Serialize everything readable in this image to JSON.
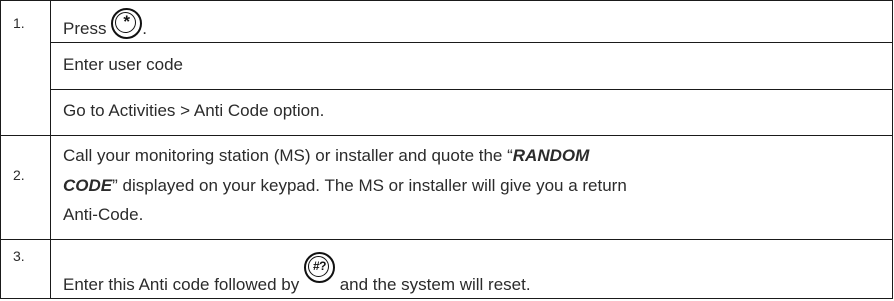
{
  "steps": [
    {
      "number": "1.",
      "line1_text": "Press",
      "line1_key": "*",
      "line1_after": ".",
      "line2": "Enter user code",
      "line3": "Go to Activities > Anti Code option."
    },
    {
      "number": "2.",
      "line1_before": "Call your monitoring station (MS) or installer and quote the “",
      "line1_emph": "RANDOM",
      "line2_emph": "CODE",
      "line2_after": "” displayed on your keypad. The MS or installer will give you a return",
      "line3": "Anti-Code."
    },
    {
      "number": "3.",
      "line1_before": "Enter this Anti code followed by",
      "line1_key": "#?",
      "line1_after": "and the system will reset."
    }
  ]
}
